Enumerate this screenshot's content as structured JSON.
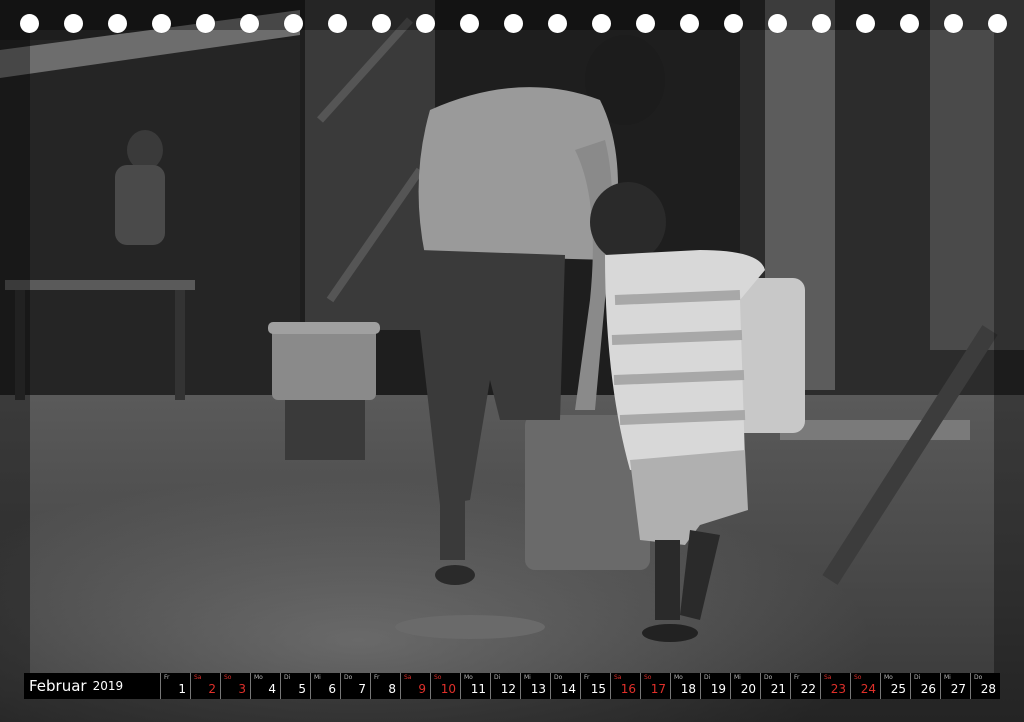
{
  "calendar": {
    "month": "Februar",
    "year": "2019",
    "days": [
      {
        "wd": "Fr",
        "n": "1",
        "red": false
      },
      {
        "wd": "Sa",
        "n": "2",
        "red": true
      },
      {
        "wd": "So",
        "n": "3",
        "red": true
      },
      {
        "wd": "Mo",
        "n": "4",
        "red": false
      },
      {
        "wd": "Di",
        "n": "5",
        "red": false
      },
      {
        "wd": "Mi",
        "n": "6",
        "red": false
      },
      {
        "wd": "Do",
        "n": "7",
        "red": false
      },
      {
        "wd": "Fr",
        "n": "8",
        "red": false
      },
      {
        "wd": "Sa",
        "n": "9",
        "red": true
      },
      {
        "wd": "So",
        "n": "10",
        "red": true
      },
      {
        "wd": "Mo",
        "n": "11",
        "red": false
      },
      {
        "wd": "Di",
        "n": "12",
        "red": false
      },
      {
        "wd": "Mi",
        "n": "13",
        "red": false
      },
      {
        "wd": "Do",
        "n": "14",
        "red": false
      },
      {
        "wd": "Fr",
        "n": "15",
        "red": false
      },
      {
        "wd": "Sa",
        "n": "16",
        "red": true
      },
      {
        "wd": "So",
        "n": "17",
        "red": true
      },
      {
        "wd": "Mo",
        "n": "18",
        "red": false
      },
      {
        "wd": "Di",
        "n": "19",
        "red": false
      },
      {
        "wd": "Mi",
        "n": "20",
        "red": false
      },
      {
        "wd": "Do",
        "n": "21",
        "red": false
      },
      {
        "wd": "Fr",
        "n": "22",
        "red": false
      },
      {
        "wd": "Sa",
        "n": "23",
        "red": true
      },
      {
        "wd": "So",
        "n": "24",
        "red": true
      },
      {
        "wd": "Mo",
        "n": "25",
        "red": false
      },
      {
        "wd": "Di",
        "n": "26",
        "red": false
      },
      {
        "wd": "Mi",
        "n": "27",
        "red": false
      },
      {
        "wd": "Do",
        "n": "28",
        "red": false
      }
    ]
  },
  "binding_hole_count": 23,
  "colors": {
    "weekend": "#e0302a",
    "bar": "#000000",
    "photo_tone": "grayscale"
  }
}
